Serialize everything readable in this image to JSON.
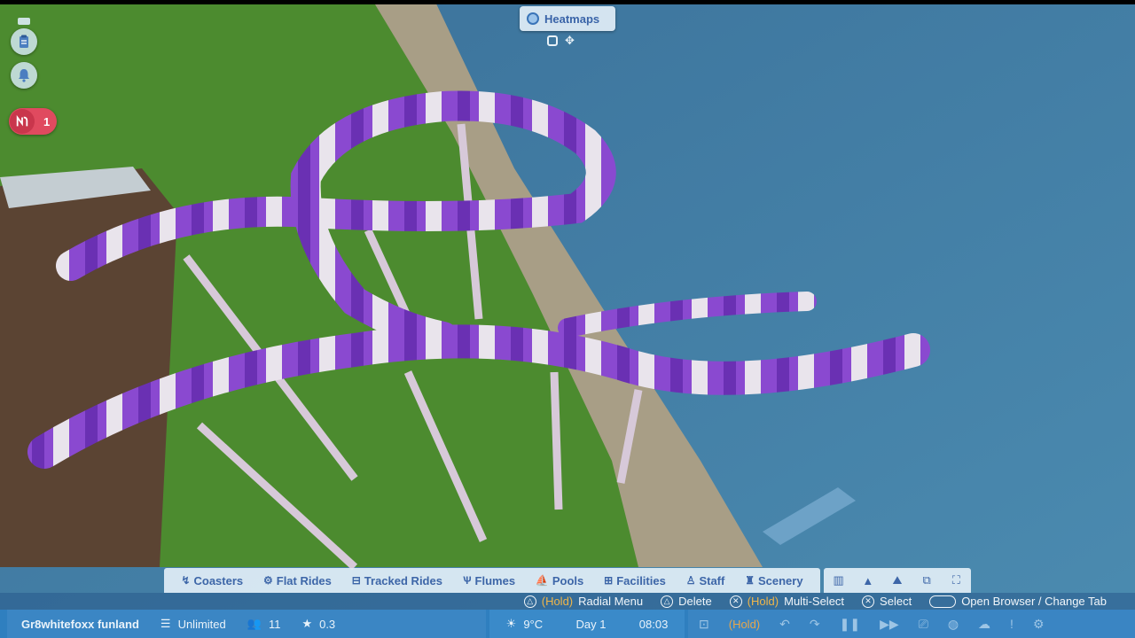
{
  "heatmaps": {
    "label": "Heatmaps",
    "icon": "heatmap-icon"
  },
  "side_buttons": [
    {
      "icon": "clipboard-icon"
    },
    {
      "icon": "bell-icon"
    }
  ],
  "alert": {
    "icon": "ride-alert-icon",
    "count": "1",
    "color": "#e04a5f"
  },
  "categories": [
    {
      "label": "Coasters",
      "icon": "coaster-icon"
    },
    {
      "label": "Flat Rides",
      "icon": "flat-ride-icon"
    },
    {
      "label": "Tracked Rides",
      "icon": "tracked-ride-icon"
    },
    {
      "label": "Flumes",
      "icon": "flume-icon"
    },
    {
      "label": "Pools",
      "icon": "pool-icon"
    },
    {
      "label": "Facilities",
      "icon": "facility-icon"
    },
    {
      "label": "Staff",
      "icon": "staff-icon"
    },
    {
      "label": "Scenery",
      "icon": "scenery-icon"
    }
  ],
  "tools": [
    "building-icon",
    "terrain-icon",
    "mountain-icon",
    "blueprint-icon",
    "expand-icon"
  ],
  "hints": {
    "radial": {
      "hold": "(Hold)",
      "label": "Radial Menu"
    },
    "delete": {
      "label": "Delete"
    },
    "multi": {
      "hold": "(Hold)",
      "label": "Multi-Select"
    },
    "select": {
      "label": "Select"
    },
    "browser": {
      "label": "Open Browser / Change Tab"
    }
  },
  "status": {
    "park_name": "Gr8whitefoxx funland",
    "money": "Unlimited",
    "guests": "11",
    "rating": "0.3",
    "temperature": "9°C",
    "day": "Day 1",
    "time": "08:03",
    "hold": "(Hold)"
  },
  "colors": {
    "accent": "#3d66a8",
    "status_bar": "#2f7fbf",
    "slide_purple": "#7a3fc4",
    "water": "#3f7fa6",
    "grass": "#4b8a2e"
  }
}
